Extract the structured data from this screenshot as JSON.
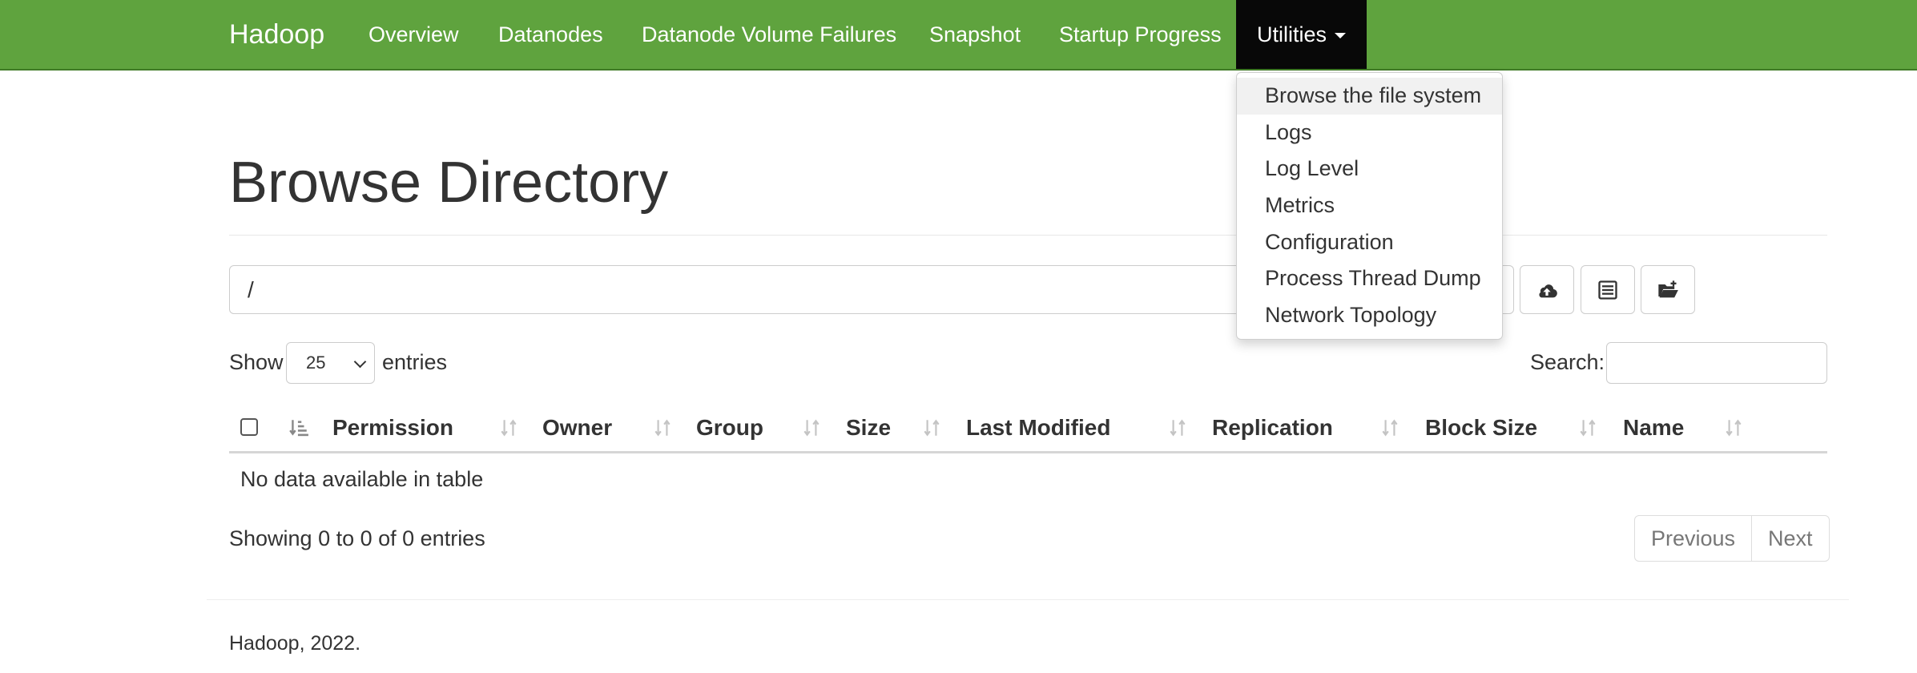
{
  "navbar": {
    "brand": "Hadoop",
    "items": [
      {
        "label": "Overview"
      },
      {
        "label": "Datanodes"
      },
      {
        "label": "Datanode Volume Failures"
      },
      {
        "label": "Snapshot"
      },
      {
        "label": "Startup Progress"
      },
      {
        "label": "Utilities"
      }
    ],
    "color": "#5fa33e",
    "active_color": "#080808"
  },
  "utilities_menu": {
    "items": [
      {
        "label": "Browse the file system"
      },
      {
        "label": "Logs"
      },
      {
        "label": "Log Level"
      },
      {
        "label": "Metrics"
      },
      {
        "label": "Configuration"
      },
      {
        "label": "Process Thread Dump"
      },
      {
        "label": "Network Topology"
      }
    ]
  },
  "page": {
    "title": "Browse Directory",
    "path_value": "/"
  },
  "toolbar": {
    "icons": [
      "cloud-upload-icon",
      "list-icon",
      "folder-open-icon"
    ]
  },
  "table_controls": {
    "show_label": "Show",
    "entries_selected": "25",
    "entries_label": "entries",
    "search_label": "Search:"
  },
  "table": {
    "columns": [
      "Permission",
      "Owner",
      "Group",
      "Size",
      "Last Modified",
      "Replication",
      "Block Size",
      "Name"
    ],
    "empty_message": "No data available in table",
    "showing_info": "Showing 0 to 0 of 0 entries"
  },
  "pagination": {
    "previous": "Previous",
    "next": "Next"
  },
  "footer": {
    "text": "Hadoop, 2022."
  }
}
